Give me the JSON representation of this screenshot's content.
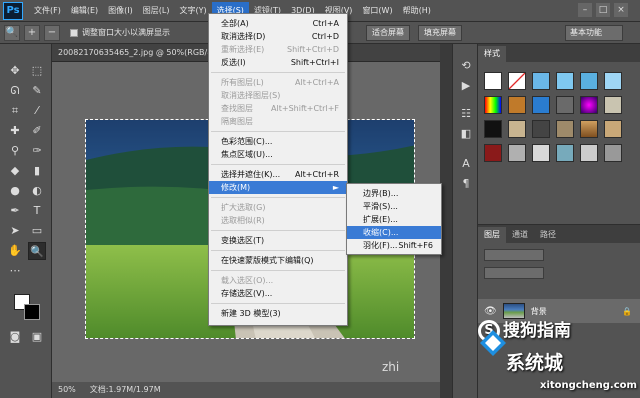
{
  "app": {
    "logo": "Ps"
  },
  "menubar": {
    "items": [
      "文件(F)",
      "编辑(E)",
      "图像(I)",
      "图层(L)",
      "文字(Y)",
      "选择(S)",
      "滤镜(T)",
      "3D(D)",
      "视图(V)",
      "窗口(W)",
      "帮助(H)"
    ],
    "active_index": 5
  },
  "window_controls": [
    "–",
    "□",
    "×"
  ],
  "options": {
    "checkbox_label": "调整窗口大小以满屏显示",
    "buttons": [
      "适合屏幕",
      "填充屏幕"
    ],
    "workspace": "基本功能"
  },
  "document": {
    "tab_title": "20082170635465_2.jpg @ 50%(RGB/8#)"
  },
  "status": {
    "zoom": "50%",
    "doc_size": "文档:1.97M/1.97M"
  },
  "select_menu": {
    "items": [
      {
        "label": "全部(A)",
        "shortcut": "Ctrl+A",
        "disabled": false
      },
      {
        "label": "取消选择(D)",
        "shortcut": "Ctrl+D",
        "disabled": false
      },
      {
        "label": "重新选择(E)",
        "shortcut": "Shift+Ctrl+D",
        "disabled": true
      },
      {
        "label": "反选(I)",
        "shortcut": "Shift+Ctrl+I",
        "disabled": false
      },
      {
        "label": "所有图层(L)",
        "shortcut": "Alt+Ctrl+A",
        "disabled": true
      },
      {
        "label": "取消选择图层(S)",
        "shortcut": "",
        "disabled": true
      },
      {
        "label": "查找图层",
        "shortcut": "Alt+Shift+Ctrl+F",
        "disabled": true
      },
      {
        "label": "隔离图层",
        "shortcut": "",
        "disabled": true
      },
      {
        "label": "色彩范围(C)...",
        "shortcut": "",
        "disabled": false
      },
      {
        "label": "焦点区域(U)...",
        "shortcut": "",
        "disabled": false
      },
      {
        "label": "选择并遮住(K)...",
        "shortcut": "Alt+Ctrl+R",
        "disabled": false
      },
      {
        "label": "修改(M)",
        "shortcut": "►",
        "disabled": false
      },
      {
        "label": "扩大选取(G)",
        "shortcut": "",
        "disabled": true
      },
      {
        "label": "选取相似(R)",
        "shortcut": "",
        "disabled": true
      },
      {
        "label": "变换选区(T)",
        "shortcut": "",
        "disabled": false
      },
      {
        "label": "在快速蒙版模式下编辑(Q)",
        "shortcut": "",
        "disabled": false
      },
      {
        "label": "载入选区(O)...",
        "shortcut": "",
        "disabled": true
      },
      {
        "label": "存储选区(V)...",
        "shortcut": "",
        "disabled": false
      },
      {
        "label": "新建 3D 模型(3)",
        "shortcut": "",
        "disabled": false
      }
    ]
  },
  "modify_submenu": {
    "items": [
      {
        "label": "边界(B)...",
        "shortcut": ""
      },
      {
        "label": "平滑(S)...",
        "shortcut": ""
      },
      {
        "label": "扩展(E)...",
        "shortcut": ""
      },
      {
        "label": "收缩(C)...",
        "shortcut": ""
      },
      {
        "label": "羽化(F)...",
        "shortcut": "Shift+F6"
      }
    ]
  },
  "styles_panel": {
    "tabs": [
      "样式"
    ]
  },
  "layers_panel": {
    "tabs": [
      "图层",
      "通道",
      "路径"
    ],
    "layer_name": "背景"
  },
  "watermarks": {
    "sogou": "搜狗指南",
    "xitongcheng": "系统城",
    "url": "xitongcheng.com",
    "zhi": "zhi"
  }
}
